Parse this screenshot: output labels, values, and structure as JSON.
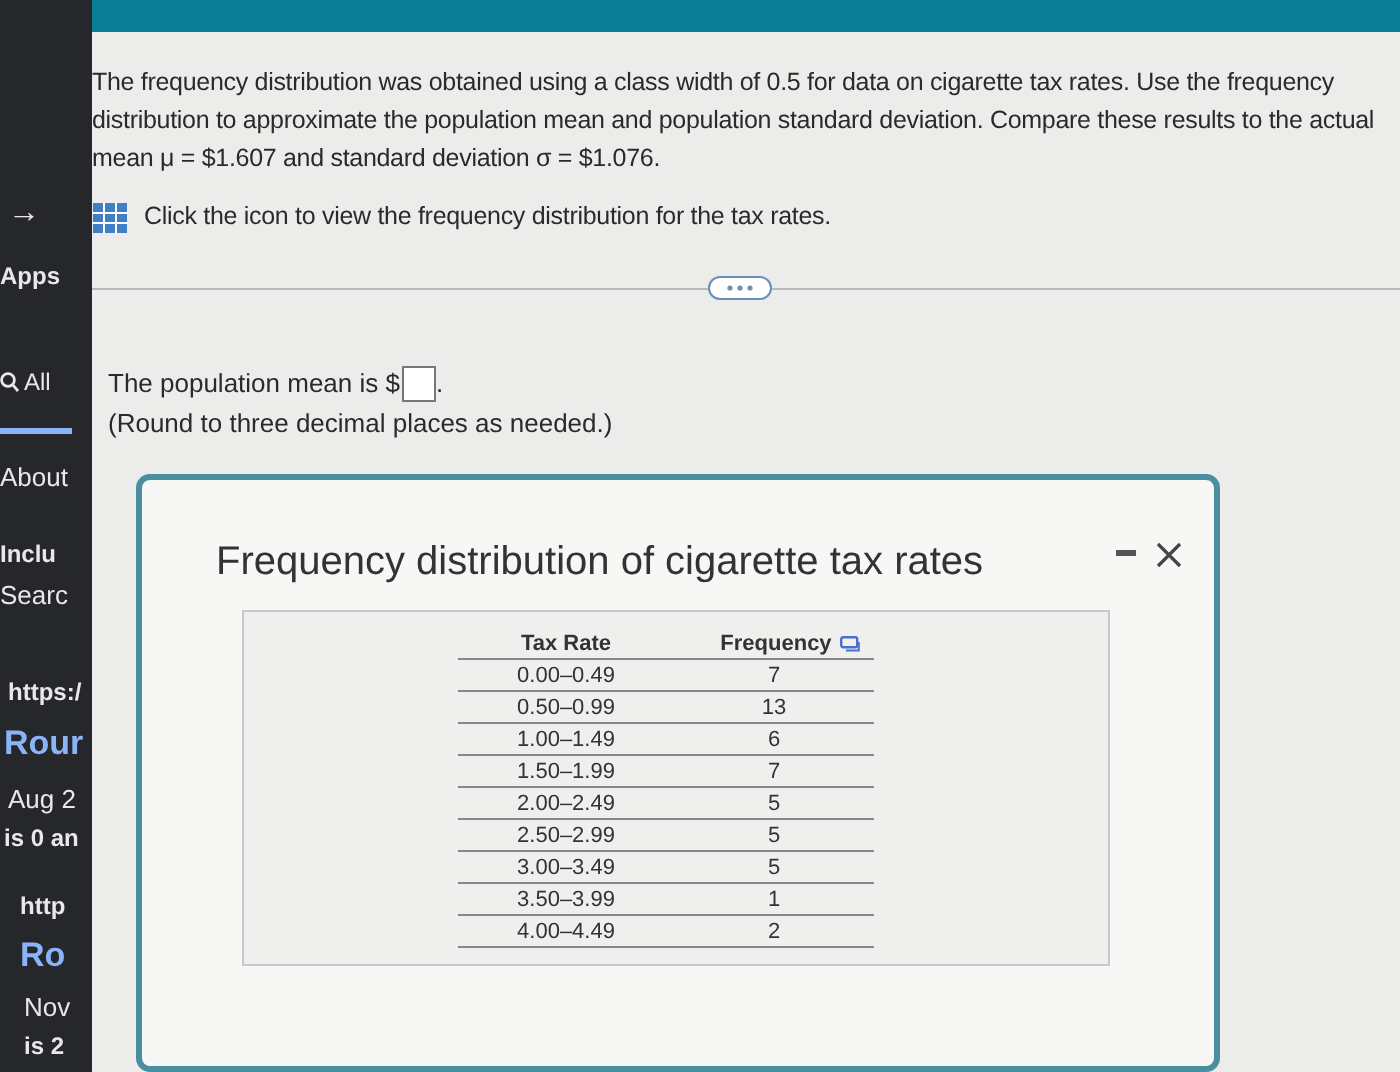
{
  "sidebar": {
    "items": [
      {
        "text": "→",
        "kind": "arrow"
      },
      {
        "text": "Apps",
        "kind": "bold"
      },
      {
        "text": "All",
        "kind": "search"
      },
      {
        "text": "About",
        "kind": "plain"
      },
      {
        "text": "Inclu",
        "kind": "bold"
      },
      {
        "text": "Searc",
        "kind": "plain"
      },
      {
        "text": "https:/",
        "kind": "bold"
      },
      {
        "text": "Rour",
        "kind": "title"
      },
      {
        "text": "Aug 2",
        "kind": "plain"
      },
      {
        "text": "is 0 an",
        "kind": "bold"
      },
      {
        "text": "http",
        "kind": "bold"
      },
      {
        "text": "Ro",
        "kind": "title"
      },
      {
        "text": "Nov",
        "kind": "plain"
      },
      {
        "text": "is 2",
        "kind": "bold"
      }
    ]
  },
  "question": {
    "text": "The frequency distribution was obtained using a class width of 0.5 for data on cigarette tax rates. Use the frequency distribution to approximate the population mean and population standard deviation. Compare these results to the actual mean μ = $1.607 and standard deviation σ = $1.076.",
    "link": "Click the icon to view the frequency distribution for the tax rates."
  },
  "answer": {
    "prefix": "The population mean is $",
    "suffix": ".",
    "hint": "(Round to three decimal places as needed.)"
  },
  "dialog": {
    "title": "Frequency distribution of cigarette tax rates",
    "table": {
      "columns": [
        "Tax Rate",
        "Frequency"
      ],
      "rows": [
        [
          "0.00–0.49",
          "7"
        ],
        [
          "0.50–0.99",
          "13"
        ],
        [
          "1.00–1.49",
          "6"
        ],
        [
          "1.50–1.99",
          "7"
        ],
        [
          "2.00–2.49",
          "5"
        ],
        [
          "2.50–2.99",
          "5"
        ],
        [
          "3.00–3.49",
          "5"
        ],
        [
          "3.50–3.99",
          "1"
        ],
        [
          "4.00–4.49",
          "2"
        ]
      ]
    }
  }
}
